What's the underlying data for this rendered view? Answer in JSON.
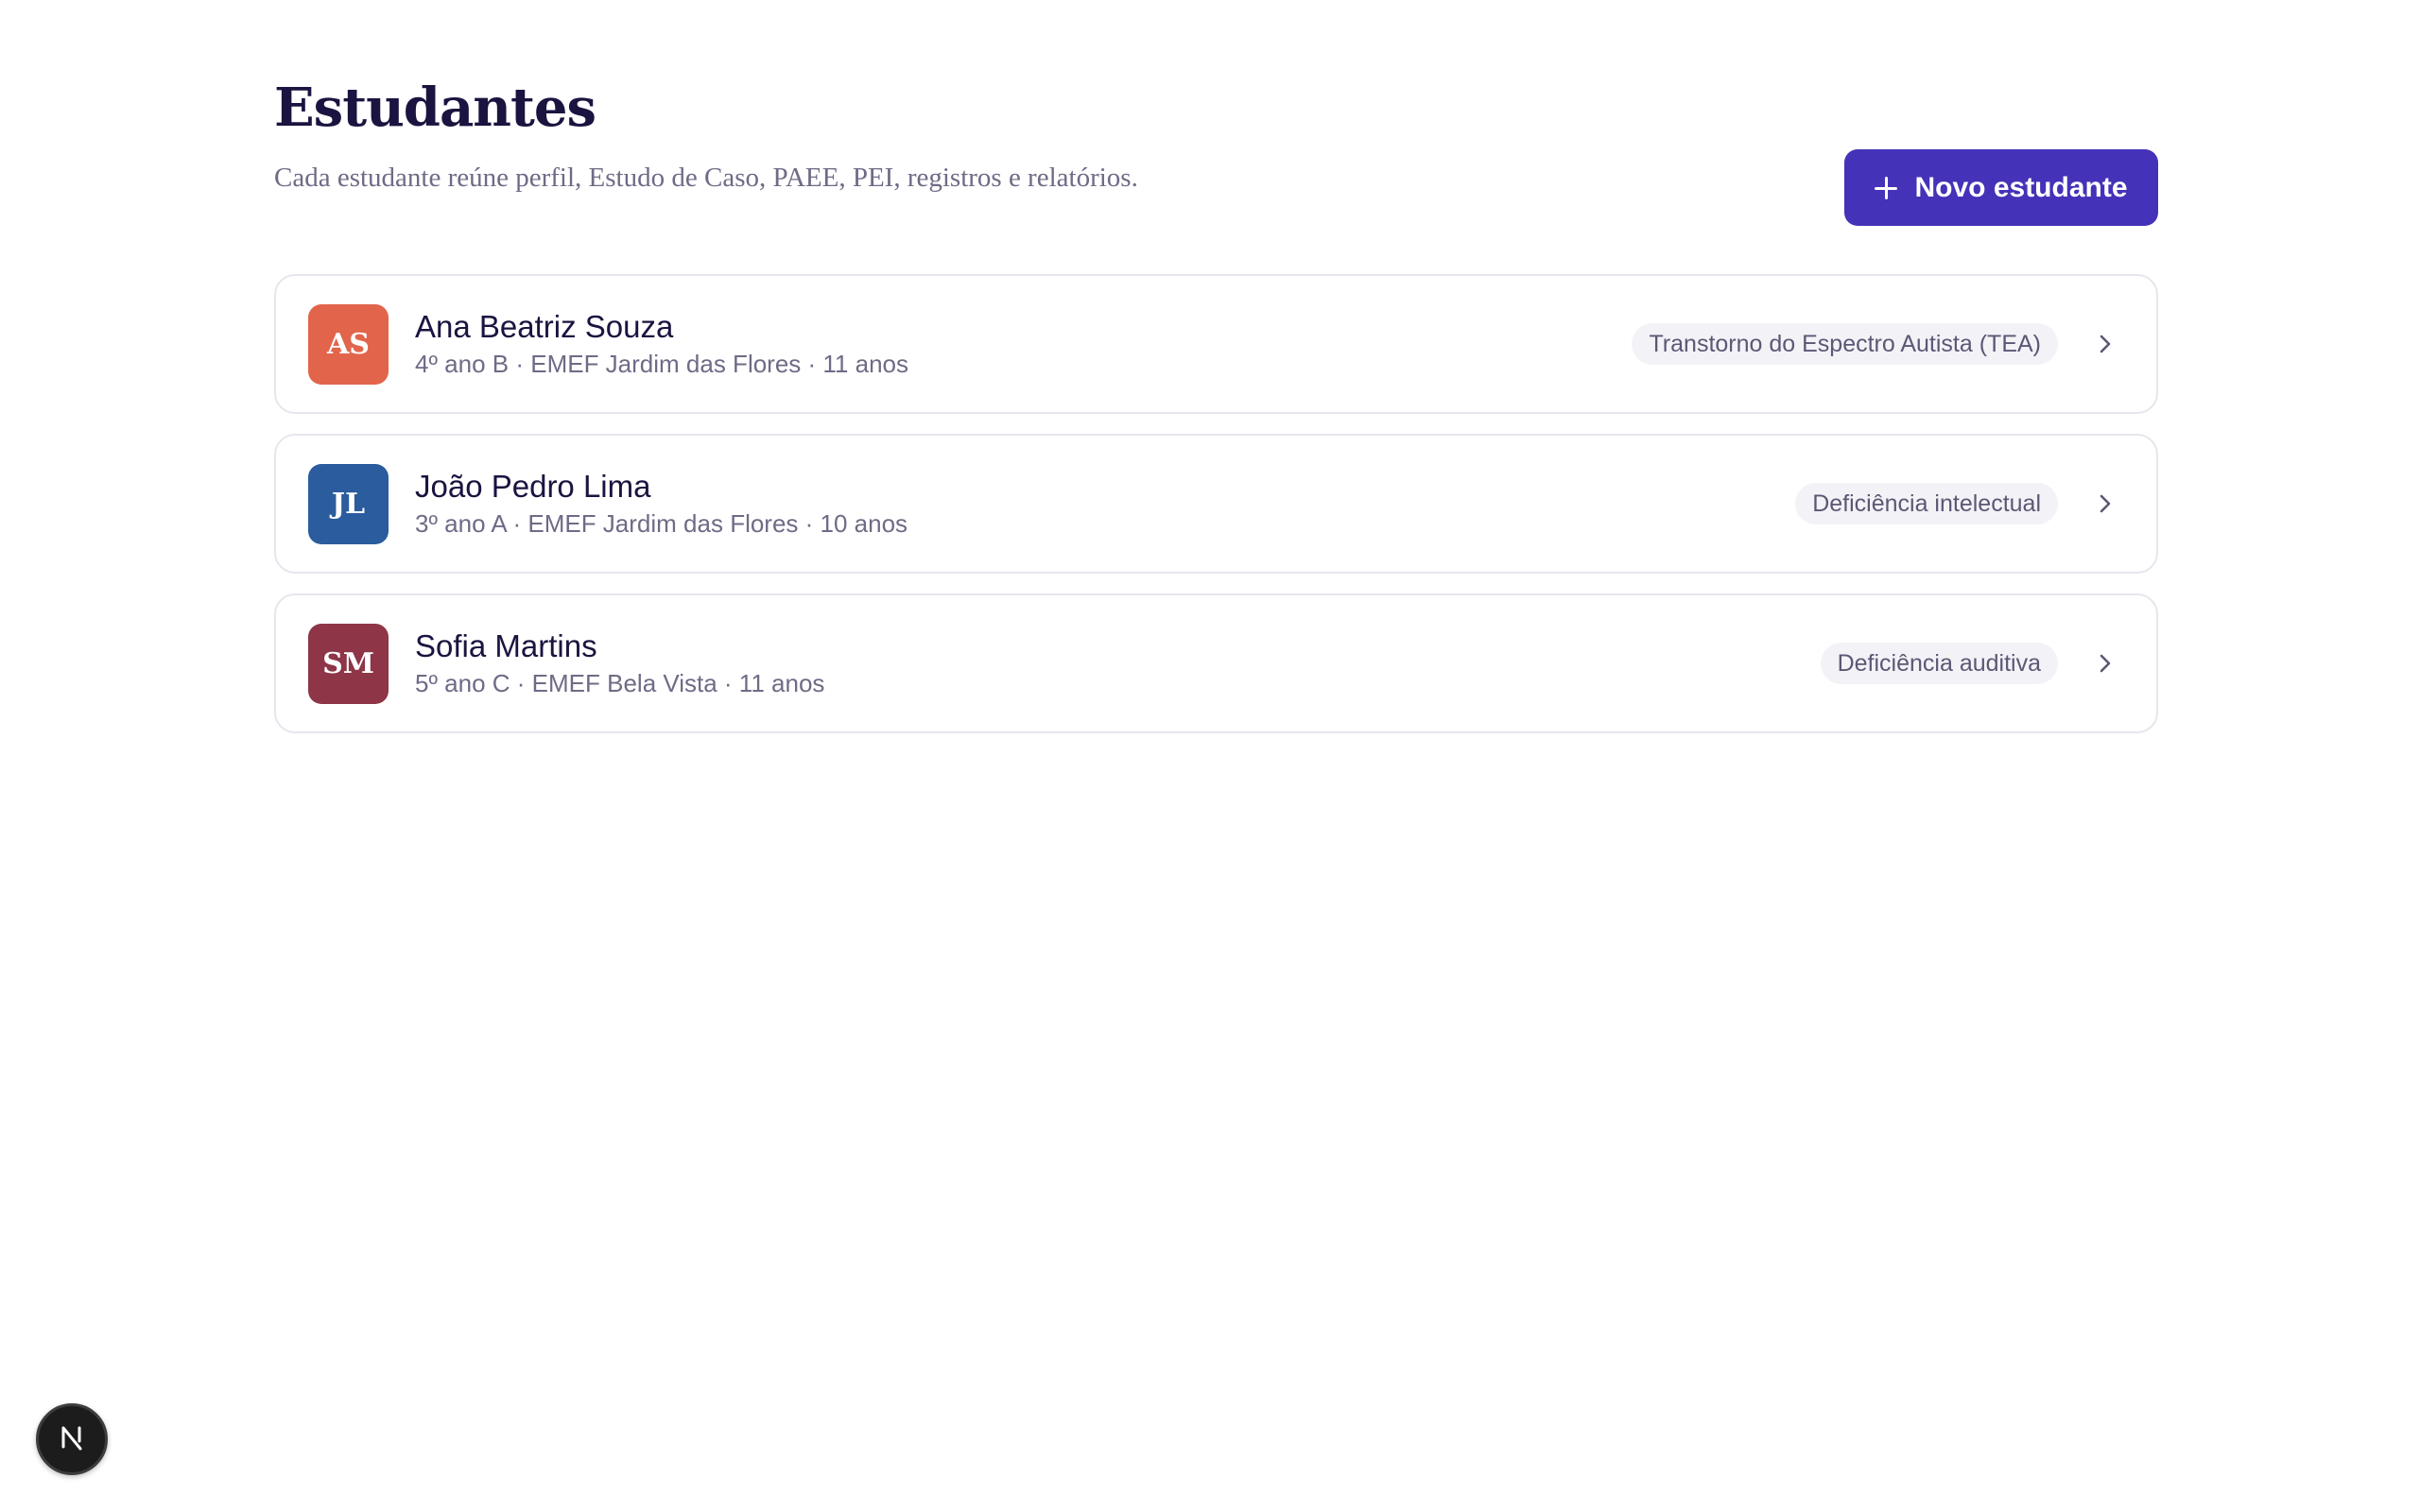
{
  "page": {
    "title": "Estudantes",
    "subtitle": "Cada estudante reúne perfil, Estudo de Caso, PAEE, PEI, registros e relatórios."
  },
  "actions": {
    "new_student_label": "Novo estudante",
    "new_student_icon": "plus-icon"
  },
  "students": [
    {
      "initials": "AS",
      "name": "Ana Beatriz Souza",
      "meta": "4º ano B · EMEF Jardim das Flores · 11 anos",
      "badge": "Transtorno do Espectro Autista (TEA)",
      "avatar_color": "#e2654b"
    },
    {
      "initials": "JL",
      "name": "João Pedro Lima",
      "meta": "3º ano A · EMEF Jardim das Flores · 10 anos",
      "badge": "Deficiência intelectual",
      "avatar_color": "#2a5c9e"
    },
    {
      "initials": "SM",
      "name": "Sofia Martins",
      "meta": "5º ano C · EMEF Bela Vista · 11 anos",
      "badge": "Deficiência auditiva",
      "avatar_color": "#8e3548"
    }
  ],
  "dev_indicator": {
    "icon": "nextjs-logo-icon"
  },
  "colors": {
    "primary": "#4432b8",
    "title": "#1a1440",
    "muted": "#6e6b86",
    "badge_bg": "#f3f2f7"
  }
}
